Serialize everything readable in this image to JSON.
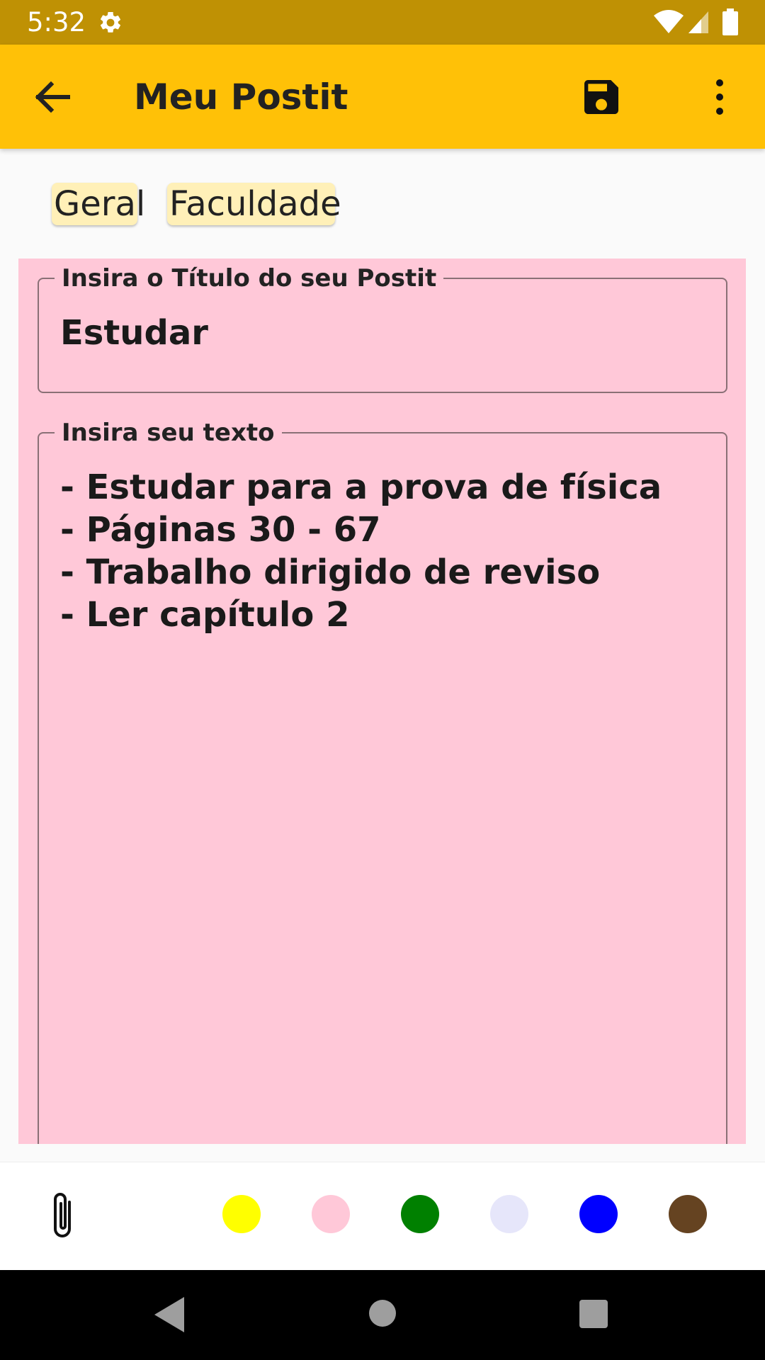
{
  "status_bar": {
    "time": "5:32",
    "icons": [
      "settings-gear-icon",
      "wifi-icon",
      "cell-signal-icon",
      "battery-icon"
    ]
  },
  "app_bar": {
    "title": "Meu Postit",
    "back_icon": "arrow-back-icon",
    "save_icon": "floppy-save-icon",
    "menu_icon": "more-vert-icon",
    "background_color": "#ffc107"
  },
  "categories": [
    "Geral",
    "Faculdade"
  ],
  "postit": {
    "background_color": "#ffc8d8",
    "title_field": {
      "label": "Insira o Título do seu Postit",
      "value": "Estudar"
    },
    "text_field": {
      "label": "Insira seu texto",
      "lines": [
        "- Estudar para a prova de física",
        "- Páginas 30 - 67",
        "- Trabalho dirigido de reviso",
        "- Ler capítulo 2"
      ]
    }
  },
  "toolbar": {
    "attach_icon": "paperclip-icon",
    "color_options": [
      "#ffff00",
      "#ffc8d8",
      "#008000",
      "#e6e6fa",
      "#0000ff",
      "#654321"
    ]
  },
  "nav_bar": {
    "icons": [
      "nav-back-icon",
      "nav-home-icon",
      "nav-recents-icon"
    ]
  }
}
